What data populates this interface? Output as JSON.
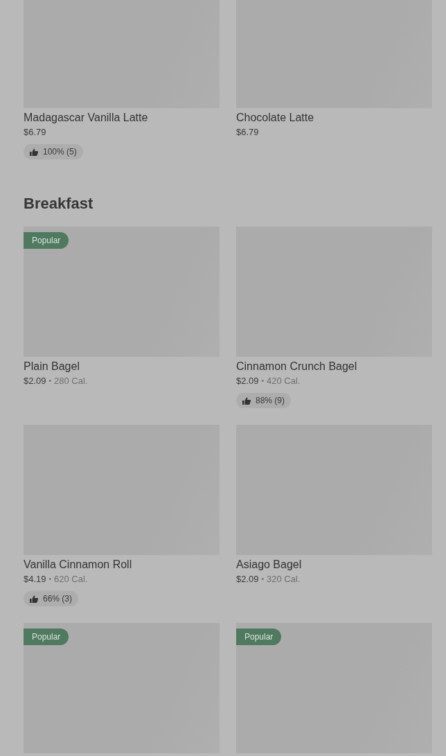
{
  "sections": [
    {
      "items": [
        {
          "name": "Madagascar Vanilla Latte",
          "price": "$6.79",
          "rating": "100% (5)"
        },
        {
          "name": "Chocolate Latte",
          "price": "$6.79"
        }
      ]
    },
    {
      "title": "Breakfast",
      "items": [
        {
          "badge": "Popular",
          "name": "Plain Bagel",
          "price": "$2.09",
          "separator": "•",
          "calories": "280 Cal."
        },
        {
          "name": "Cinnamon Crunch Bagel",
          "price": "$2.09",
          "separator": "•",
          "calories": "420 Cal.",
          "rating": "88% (9)"
        },
        {
          "name": "Vanilla Cinnamon Roll",
          "price": "$4.19",
          "separator": "•",
          "calories": "620 Cal.",
          "rating": "66% (3)"
        },
        {
          "name": "Asiago Bagel",
          "price": "$2.09",
          "separator": "•",
          "calories": "320 Cal."
        },
        {
          "badge": "Popular"
        },
        {
          "badge": "Popular"
        }
      ]
    }
  ]
}
